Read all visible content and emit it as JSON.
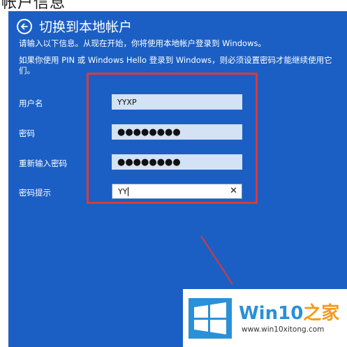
{
  "background": {
    "heading": "帐户信息"
  },
  "dialog": {
    "title": "切换到本地帐户",
    "description_line1": "请输入以下信息。从现在开始，你将使用本地帐户登录到 Windows。",
    "description_line2": "如果你使用 PIN 或 Windows Hello 登录到 Windows，则必须设置密码才能继续使用它",
    "description_line3": "们。",
    "fields": [
      {
        "label": "用户名",
        "value": "YYXP"
      },
      {
        "label": "密码",
        "value": "●●●●●●●●"
      },
      {
        "label": "重新输入密码",
        "value": "●●●●●●●●"
      },
      {
        "label": "密码提示",
        "value": "YY"
      }
    ],
    "clear_glyph": "✕"
  },
  "watermark": {
    "brand_main": "Win10",
    "brand_accent": "之家",
    "url": "www.win10xitong.com"
  },
  "colors": {
    "dialog_bg": "#1b5fc4",
    "field_bg": "#d3e2f5",
    "highlight": "#d83a3a",
    "logo_blue": "#2a90d8",
    "logo_orange": "#f39a1e"
  },
  "icons": {
    "back": "back-arrow-icon",
    "clear": "close-icon",
    "logo": "windows-logo-icon"
  }
}
